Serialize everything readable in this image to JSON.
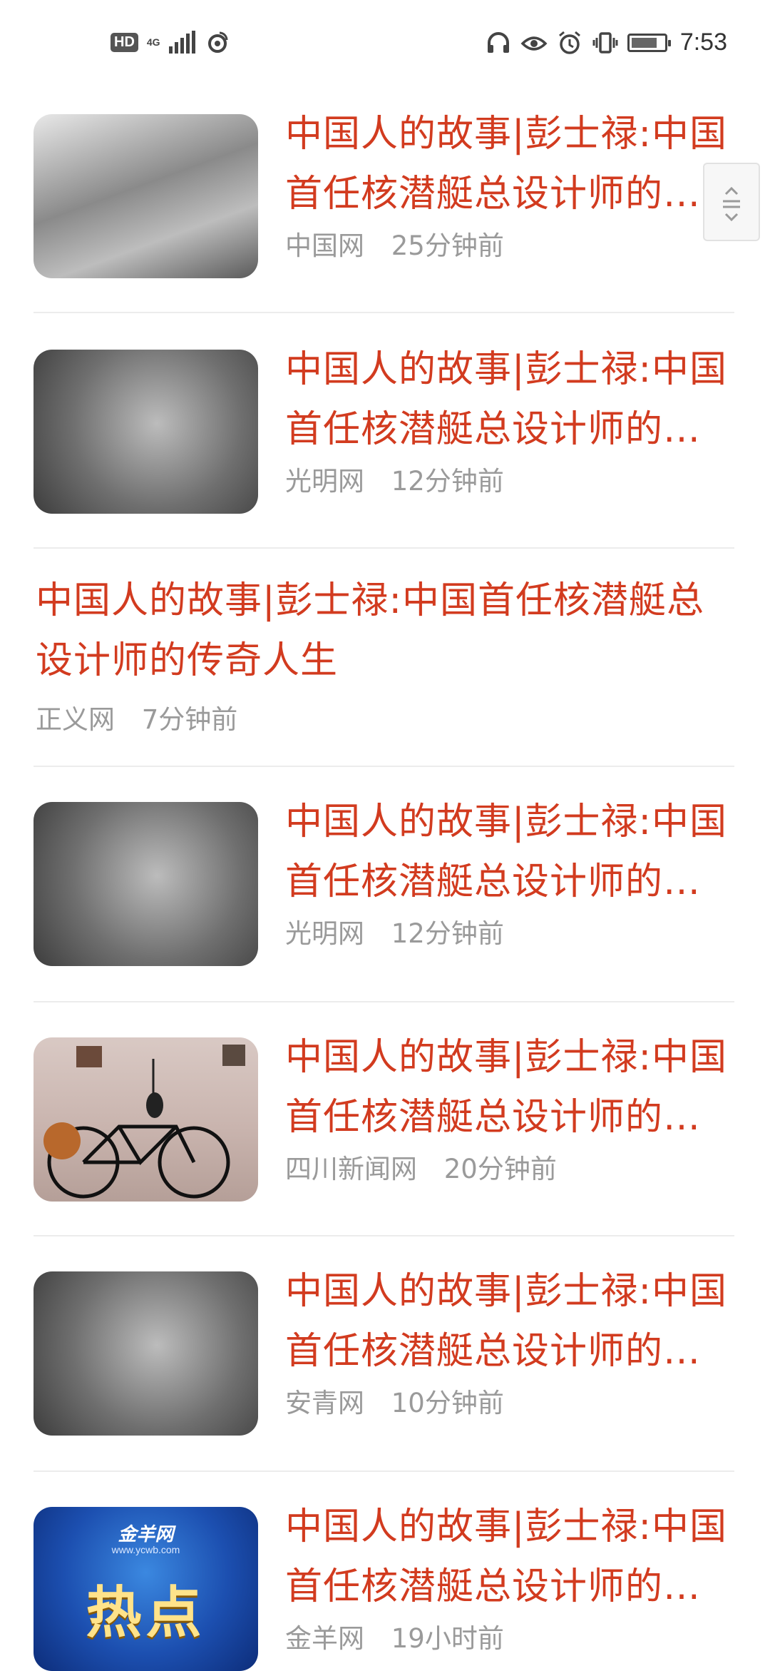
{
  "status_bar": {
    "hd": "HD",
    "network": "4G",
    "time": "7:53"
  },
  "feed": [
    {
      "title": "中国人的故事|彭士禄:中国首任核潜艇总设计师的传奇人生",
      "source": "中国网",
      "time": "25分钟前",
      "thumb": "photo-lab-icon"
    },
    {
      "title": "中国人的故事|彭士禄:中国首任核潜艇总设计师的传奇人生",
      "source": "光明网",
      "time": "12分钟前",
      "thumb": "family-photo-icon"
    },
    {
      "title": "中国人的故事|彭士禄:中国首任核潜艇总设计师的传奇人生",
      "source": "正义网",
      "time": "7分钟前",
      "thumb": null
    },
    {
      "title": "中国人的故事|彭士禄:中国首任核潜艇总设计师的传奇人生",
      "source": "光明网",
      "time": "12分钟前",
      "thumb": "family-photo-icon"
    },
    {
      "title": "中国人的故事|彭士禄:中国首任核潜艇总设计师的传奇人生",
      "source": "四川新闻网",
      "time": "20分钟前",
      "thumb": "bicycle-photo-icon"
    },
    {
      "title": "中国人的故事|彭士禄:中国首任核潜艇总设计师的传奇人生",
      "source": "安青网",
      "time": "10分钟前",
      "thumb": "family-photo-icon"
    },
    {
      "title": "中国人的故事|彭士禄:中国首任核潜艇总设计师的传奇人生",
      "source": "金羊网",
      "time": "19小时前",
      "thumb": "hot-news-thumb"
    }
  ],
  "hot_thumb": {
    "brand": "金羊网",
    "url_text": "www.ycwb.com",
    "label": "热点"
  },
  "colors": {
    "title": "#d23b1f",
    "meta": "#9a9a9a",
    "divider": "#ececec"
  }
}
